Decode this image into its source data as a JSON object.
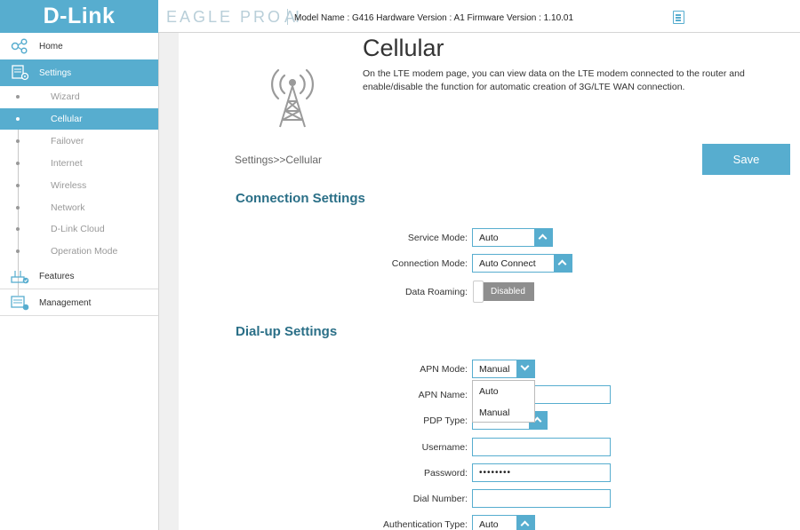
{
  "brand": {
    "logo": "D-Link",
    "product_main": "EAGLE PRO",
    "product_ai": "AI"
  },
  "header": {
    "model_info": "Model Name : G416 Hardware Version : A1 Firmware Version : 1.10.01",
    "doc_icon": "document-icon"
  },
  "sidebar": {
    "main": [
      {
        "label": "Home",
        "icon": "home-network-icon"
      },
      {
        "label": "Settings",
        "icon": "settings-icon"
      },
      {
        "label": "Features",
        "icon": "features-icon"
      },
      {
        "label": "Management",
        "icon": "management-icon"
      }
    ],
    "sub": [
      "Wizard",
      "Cellular",
      "Failover",
      "Internet",
      "Wireless",
      "Network",
      "D-Link Cloud",
      "Operation Mode"
    ],
    "active_sub": "Cellular"
  },
  "page": {
    "title": "Cellular",
    "description": "On the LTE modem page, you can view data on the LTE modem connected to the router and enable/disable the function for automatic creation of 3G/LTE WAN connection.",
    "breadcrumb": "Settings>>Cellular",
    "save_label": "Save",
    "icon": "cell-tower-icon"
  },
  "connection": {
    "title": "Connection Settings",
    "service_mode_label": "Service Mode:",
    "service_mode_value": "Auto",
    "connection_mode_label": "Connection Mode:",
    "connection_mode_value": "Auto Connect",
    "data_roaming_label": "Data Roaming:",
    "data_roaming_value": "Disabled"
  },
  "dialup": {
    "title": "Dial-up Settings",
    "apn_mode_label": "APN Mode:",
    "apn_mode_value": "Manual",
    "apn_mode_options": [
      "Auto",
      "Manual"
    ],
    "apn_name_label": "APN Name:",
    "apn_name_value": "",
    "pdp_type_label": "PDP Type:",
    "pdp_type_value": "",
    "username_label": "Username:",
    "username_value": "",
    "password_label": "Password:",
    "password_value": "••••••••",
    "dial_number_label": "Dial Number:",
    "dial_number_value": "",
    "auth_type_label": "Authentication Type:",
    "auth_type_value": "Auto"
  },
  "colors": {
    "accent": "#57adcf",
    "heading": "#2a6f87",
    "toggle_off": "#8e8e8e"
  }
}
